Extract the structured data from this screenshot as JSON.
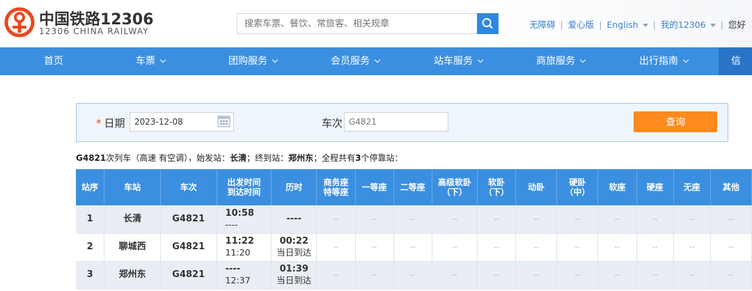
{
  "header": {
    "logo_cn": "中国铁路12306",
    "logo_en": "12306 CHINA RAILWAY",
    "search_placeholder": "搜索车票、餐饮、常旅客、相关规章",
    "links": {
      "accessible": "无障碍",
      "care": "爱心版",
      "english": "English",
      "my12306": "我的12306",
      "greeting": "您好"
    }
  },
  "nav": {
    "items": [
      "首页",
      "车票",
      "团购服务",
      "会员服务",
      "站车服务",
      "商旅服务",
      "出行指南",
      "信"
    ]
  },
  "query": {
    "date_label": "日期",
    "required_mark": "*",
    "date_value": "2023-12-08",
    "train_label": "车次",
    "train_value": "G4821",
    "search_button": "查询"
  },
  "info": {
    "train": "G4821",
    "text1": "次列车（高速 有空调），始发站：",
    "origin": "长清",
    "text2": "；终到站：",
    "destination": "郑州东",
    "text3": "；全程共有",
    "count": "3",
    "text4": "个停靠站："
  },
  "table": {
    "headers": [
      [
        "站序"
      ],
      [
        "车站"
      ],
      [
        "车次"
      ],
      [
        "出发时间",
        "到达时间"
      ],
      [
        "历时"
      ],
      [
        "商务座",
        "特等座"
      ],
      [
        "一等座"
      ],
      [
        "二等座"
      ],
      [
        "高级软卧",
        "（下）"
      ],
      [
        "软卧",
        "（下）"
      ],
      [
        "动卧"
      ],
      [
        "硬卧",
        "（中）"
      ],
      [
        "软座"
      ],
      [
        "硬座"
      ],
      [
        "无座"
      ],
      [
        "其他"
      ]
    ],
    "rows": [
      {
        "seq": "1",
        "station": "长清",
        "train": "G4821",
        "depart": "10:58",
        "arrive": "----",
        "duration": "----",
        "duration_note": "",
        "seats": [
          "--",
          "--",
          "--",
          "--",
          "--",
          "--",
          "--",
          "--",
          "--",
          "--",
          "--"
        ]
      },
      {
        "seq": "2",
        "station": "聊城西",
        "train": "G4821",
        "depart": "11:22",
        "arrive": "11:20",
        "duration": "00:22",
        "duration_note": "当日到达",
        "seats": [
          "--",
          "--",
          "--",
          "--",
          "--",
          "--",
          "--",
          "--",
          "--",
          "--",
          "--"
        ]
      },
      {
        "seq": "3",
        "station": "郑州东",
        "train": "G4821",
        "depart": "----",
        "arrive": "12:37",
        "duration": "01:39",
        "duration_note": "当日到达",
        "seats": [
          "--",
          "--",
          "--",
          "--",
          "--",
          "--",
          "--",
          "--",
          "--",
          "--",
          "--"
        ]
      }
    ]
  },
  "colors": {
    "brand_red": "#e8491d",
    "nav_blue": "#3b8fe0",
    "button_orange": "#ff8a1e"
  }
}
